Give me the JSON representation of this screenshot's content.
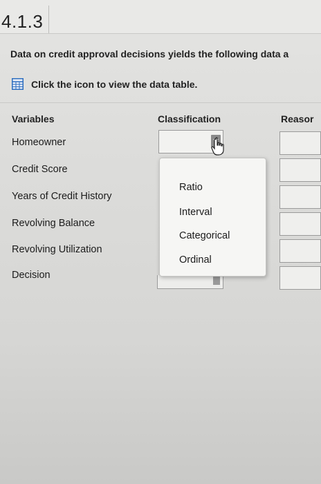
{
  "header": {
    "section_number": "4.1.3"
  },
  "question": {
    "intro_text": "Data on credit approval decisions yields the following data a",
    "data_link_text": "Click the icon to view the data table."
  },
  "table": {
    "columns": {
      "variables": "Variables",
      "classification": "Classification",
      "reason": "Reasor"
    },
    "variables": [
      "Homeowner",
      "Credit Score",
      "Years of Credit History",
      "Revolving Balance",
      "Revolving Utilization",
      "Decision"
    ]
  },
  "dropdown": {
    "options": [
      "Ratio",
      "Interval",
      "Categorical",
      "Ordinal"
    ]
  },
  "icons": {
    "data_table": "data-table-grid-icon",
    "cursor": "hand-pointer-cursor-icon",
    "dropdown_arrow": "chevron-down-icon"
  },
  "colors": {
    "icon_blue": "#2f6fbf",
    "background": "#dcdcda"
  }
}
